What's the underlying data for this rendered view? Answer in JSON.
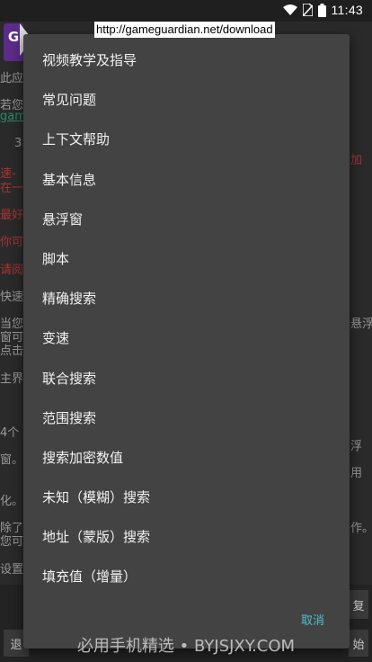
{
  "status_bar": {
    "time": "11:43"
  },
  "header": {
    "url": "http://gameguardian.net/download",
    "app_icon_letter": "G"
  },
  "background": {
    "snippets": [
      {
        "text": "此应",
        "style": "gray"
      },
      {
        "text": "若您",
        "style": "gray"
      },
      {
        "text": "gam",
        "style": "green"
      },
      {
        "text": "3",
        "style": "gray"
      },
      {
        "text": "速-",
        "style": "red"
      },
      {
        "text": "在一",
        "style": "red"
      },
      {
        "text": "最好",
        "style": "red"
      },
      {
        "text": "你可",
        "style": "red"
      },
      {
        "text": "请阅",
        "style": "red"
      },
      {
        "text": "快速",
        "style": "gray"
      },
      {
        "text": "当您",
        "style": "gray"
      },
      {
        "text": "窗可",
        "style": "gray"
      },
      {
        "text": "点击",
        "style": "gray"
      },
      {
        "text": "主界",
        "style": "gray"
      },
      {
        "text": "4个",
        "style": "gray"
      },
      {
        "text": "窗。",
        "style": "gray"
      },
      {
        "text": "化。",
        "style": "gray"
      },
      {
        "text": "除了",
        "style": "gray"
      },
      {
        "text": "您可",
        "style": "gray"
      },
      {
        "text": "设置",
        "style": "gray"
      },
      {
        "text": "加",
        "style": "red"
      },
      {
        "text": "悬浮",
        "style": "gray"
      },
      {
        "text": "浮",
        "style": "gray"
      },
      {
        "text": "用",
        "style": "gray"
      },
      {
        "text": "作。",
        "style": "gray"
      }
    ],
    "left_bottom_button": "退",
    "right_mid_button": "复",
    "right_bottom_button": "始"
  },
  "dialog": {
    "items": [
      "视频教学及指导",
      "常见问题",
      "上下文帮助",
      "基本信息",
      "悬浮窗",
      "脚本",
      "精确搜索",
      "变速",
      "联合搜索",
      "范围搜索",
      "搜索加密数值",
      "未知（模糊）搜索",
      "地址（蒙版）搜索",
      "填充值（增量）"
    ],
    "cancel_label": "取消"
  },
  "watermark": "必用手机精选 • BYJSJXY.COM",
  "colors": {
    "dialog_bg": "#434343",
    "accent": "#4dc0cf",
    "background": "#2a2a2a"
  }
}
